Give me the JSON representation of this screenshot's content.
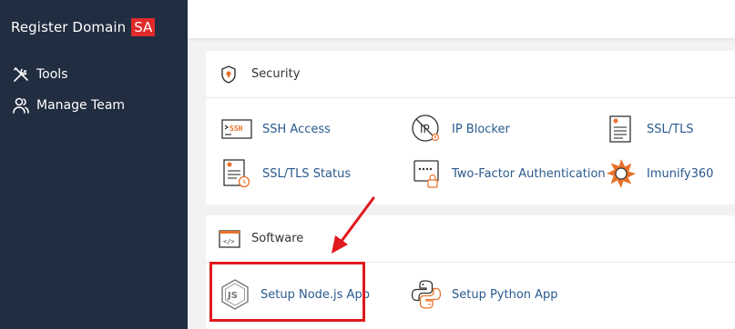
{
  "sidebar": {
    "brand": {
      "name": "Register Domain",
      "badge": "SA"
    },
    "items": [
      {
        "label": "Tools",
        "icon": "tools-icon"
      },
      {
        "label": "Manage Team",
        "icon": "users-icon"
      }
    ]
  },
  "security": {
    "title": "Security",
    "icon": "shield-icon",
    "items": [
      {
        "label": "SSH Access",
        "icon": "ssh-icon"
      },
      {
        "label": "IP Blocker",
        "icon": "ip-blocker-icon"
      },
      {
        "label": "SSL/TLS",
        "icon": "certificate-icon"
      },
      {
        "label": "SSL/TLS Status",
        "icon": "certificate-status-icon"
      },
      {
        "label": "Two-Factor Authentication",
        "icon": "two-factor-icon"
      },
      {
        "label": "Imunify360",
        "icon": "imunify360-icon"
      }
    ]
  },
  "software": {
    "title": "Software",
    "icon": "code-window-icon",
    "items": [
      {
        "label": "Setup Node.js App",
        "icon": "nodejs-icon"
      },
      {
        "label": "Setup Python App",
        "icon": "python-icon"
      }
    ]
  },
  "colors": {
    "sidebar_bg": "#212d40",
    "badge": "#e02b2b",
    "link": "#2a5a8e",
    "accent_orange": "#e8712a",
    "annotation_red": "#e0191d"
  }
}
